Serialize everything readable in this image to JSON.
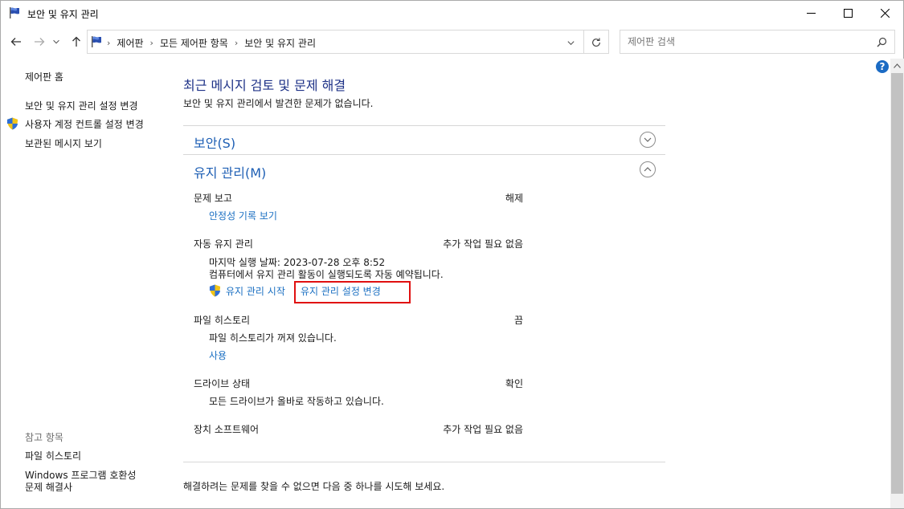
{
  "window": {
    "title": "보안 및 유지 관리",
    "icon": "flag-icon"
  },
  "nav": {
    "breadcrumbs": [
      "제어판",
      "모든 제어판 항목",
      "보안 및 유지 관리"
    ],
    "search_placeholder": "제어판 검색"
  },
  "sidebar": {
    "home": "제어판 홈",
    "links": [
      "보안 및 유지 관리 설정 변경",
      "사용자 계정 컨트롤 설정 변경",
      "보관된 메시지 보기"
    ],
    "see_also_heading": "참고 항목",
    "see_also": [
      "파일 히스토리",
      "Windows 프로그램 호환성",
      "문제 해결사"
    ]
  },
  "main": {
    "title": "최근 메시지 검토 및 문제 해결",
    "subtitle": "보안 및 유지 관리에서 발견한 문제가 없습니다.",
    "security_heading": "보안(S)",
    "maintenance_heading": "유지 관리(M)",
    "items": {
      "problem_report": {
        "label": "문제 보고",
        "status": "해제",
        "link": "안정성 기록 보기"
      },
      "auto_maintenance": {
        "label": "자동 유지 관리",
        "status": "추가 작업 필요 없음",
        "last_run": "마지막 실행 날짜: 2023-07-28 오후 8:52",
        "description": "컴퓨터에서 유지 관리 활동이 실행되도록 자동 예약됩니다.",
        "start_link": "유지 관리 시작",
        "settings_link": "유지 관리 설정 변경"
      },
      "file_history": {
        "label": "파일 히스토리",
        "status": "끔",
        "detail": "파일 히스토리가 꺼져 있습니다.",
        "link": "사용"
      },
      "drive_status": {
        "label": "드라이브 상태",
        "status": "확인",
        "detail": "모든 드라이브가 올바로 작동하고 있습니다."
      },
      "device_software": {
        "label": "장치 소프트웨어",
        "status": "추가 작업 필요 없음"
      }
    },
    "footer": "해결하려는 문제를 찾을 수 없으면 다음 중 하나를 시도해 보세요."
  },
  "colors": {
    "title_blue": "#1e3287",
    "link_blue": "#1a6fc2",
    "highlight_red": "#e01010"
  }
}
